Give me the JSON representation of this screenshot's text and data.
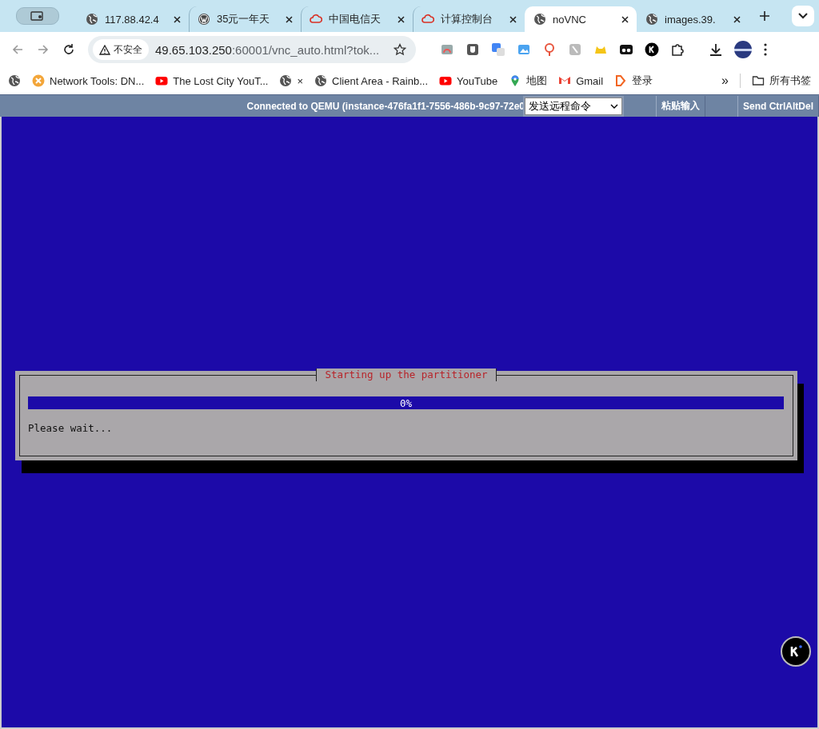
{
  "tabs": [
    {
      "title": "117.88.42.4",
      "kind": "globe",
      "selected": false
    },
    {
      "title": "35元一年天",
      "kind": "wordpress",
      "selected": false
    },
    {
      "title": "中国电信天",
      "kind": "cloud",
      "selected": false
    },
    {
      "title": "计算控制台",
      "kind": "cloud",
      "selected": false
    },
    {
      "title": "noVNC",
      "kind": "globe",
      "selected": true
    },
    {
      "title": "images.39.",
      "kind": "globe",
      "selected": false
    }
  ],
  "toolbar": {
    "security_label": "不安全",
    "url_host": "49.65.103.250",
    "url_path": ":60001/vnc_auto.html?tok..."
  },
  "bookmarks": [
    {
      "kind": "globe"
    },
    {
      "label": "Network Tools: DN...",
      "kind": "network-tools"
    },
    {
      "label": "The Lost City YouT...",
      "kind": "youtube"
    },
    {
      "label": "×",
      "kind": "globe"
    },
    {
      "label": "Client Area - Rainb...",
      "kind": "globe"
    },
    {
      "label": "YouTube",
      "kind": "youtube"
    },
    {
      "label": "地图",
      "kind": "maps"
    },
    {
      "label": "Gmail",
      "kind": "gmail"
    },
    {
      "label": "登录",
      "kind": "login"
    }
  ],
  "bookmarks_overflow": "»",
  "all_bookmarks": "所有书签",
  "vnc_bar": {
    "status": "Connected to QEMU (instance-476fa1f1-7556-486b-9c97-72e0",
    "command_select": "发送远程命令",
    "buttons": [
      "粘贴输入",
      "Send CtrlAltDel"
    ]
  },
  "installer_dialog": {
    "title": "Starting up the partitioner",
    "progress": {
      "level": 0,
      "label": "0%"
    },
    "message": "Please wait..."
  }
}
